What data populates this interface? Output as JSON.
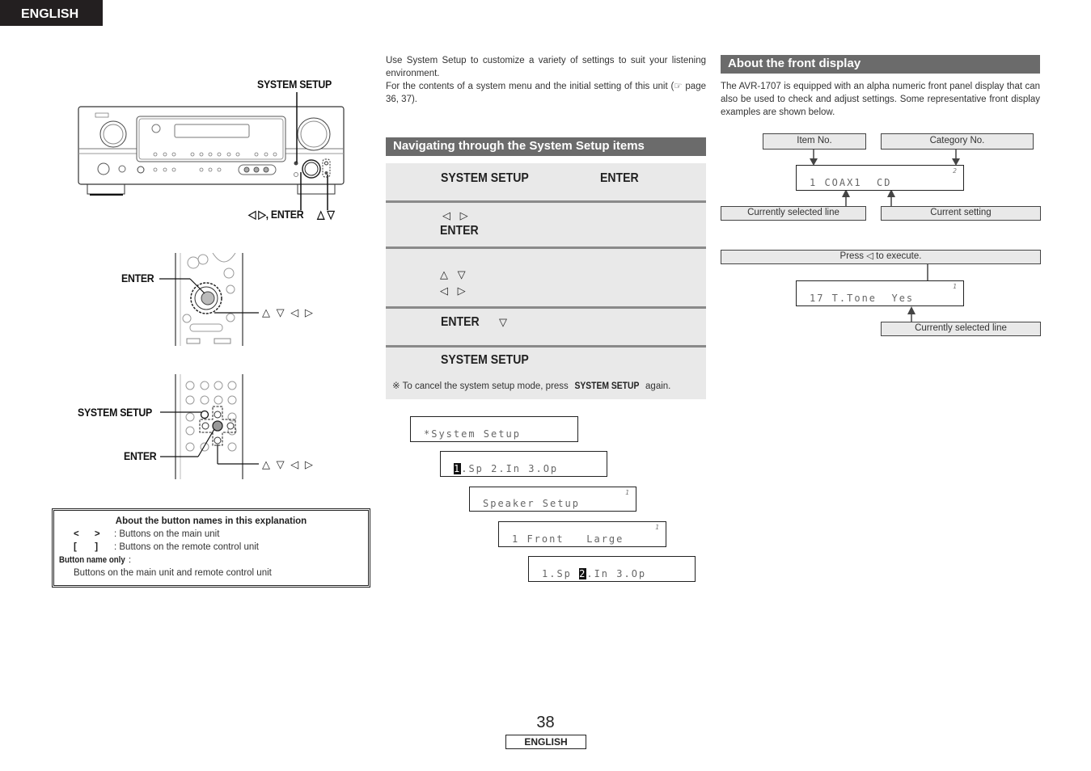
{
  "header": {
    "language_tab": "ENGLISH"
  },
  "left_column": {
    "main_unit_callouts": {
      "system_setup": "SYSTEM SETUP",
      "cursor_enter": "◁ ▷, ENTER",
      "up_down": "△ ▽"
    },
    "remote1_callouts": {
      "enter": "ENTER",
      "arrows": "△ ▽ ◁ ▷"
    },
    "remote2_callouts": {
      "system_setup": "SYSTEM SETUP",
      "enter": "ENTER",
      "arrows": "△ ▽ ◁ ▷"
    },
    "button_names_box": {
      "title": "About the button names in this explanation",
      "rows": [
        {
          "symbol": "<      >",
          "text": ": Buttons on the main unit"
        },
        {
          "symbol": "[       ]",
          "text": ": Buttons on the remote control unit"
        }
      ],
      "button_name_only_label": "Button name only",
      "button_name_only_colon": " :",
      "button_name_only_text": "Buttons on the main unit and remote control unit"
    }
  },
  "middle_column": {
    "intro_line1": "Use System Setup to customize a variety of settings to suit your listening environment.",
    "intro_line2": "For the contents of a system menu and the initial setting of this unit (☞ page 36, 37).",
    "section_title": "Navigating through the System Setup items",
    "steps": [
      {
        "label_a": "SYSTEM SETUP",
        "label_b": "ENTER"
      },
      {
        "symbols": "◁ ▷",
        "label_a": "ENTER"
      },
      {
        "symbols_a": "△ ▽",
        "symbols_b": "◁ ▷"
      },
      {
        "label_a": "ENTER",
        "symbols": "▽"
      },
      {
        "label_a": "SYSTEM SETUP"
      }
    ],
    "note_prefix": "※ To cancel the system setup mode, press ",
    "note_bold": "SYSTEM SETUP",
    "note_suffix": " again.",
    "lcd_sequence": [
      {
        "text": "*System Setup",
        "sup": ""
      },
      {
        "highlight": "1",
        "text": ".Sp 2.In 3.Op",
        "sup": ""
      },
      {
        "text": "Speaker Setup",
        "sup": "1"
      },
      {
        "text": "1 Front   Large",
        "sup": "1"
      },
      {
        "pre": "1.Sp ",
        "highlight": "2",
        "text": ".In 3.Op",
        "sup": ""
      }
    ]
  },
  "right_column": {
    "section_title": "About the front display",
    "description": "The AVR-1707 is equipped with an alpha numeric front panel display that can also be used to check and adjust settings. Some representative front display examples are shown below.",
    "diagram1": {
      "item_no_label": "Item No.",
      "category_no_label": "Category No.",
      "display_text": "1 COAX1  CD",
      "display_sup": "2",
      "selected_line_label": "Currently selected line",
      "current_setting_label": "Current setting"
    },
    "diagram2": {
      "execute_label": "Press ◁ to execute.",
      "display_text": "17 T.Tone  Yes",
      "display_sup": "1",
      "selected_line_label": "Currently selected line"
    }
  },
  "footer": {
    "page_number": "38",
    "language": "ENGLISH"
  }
}
